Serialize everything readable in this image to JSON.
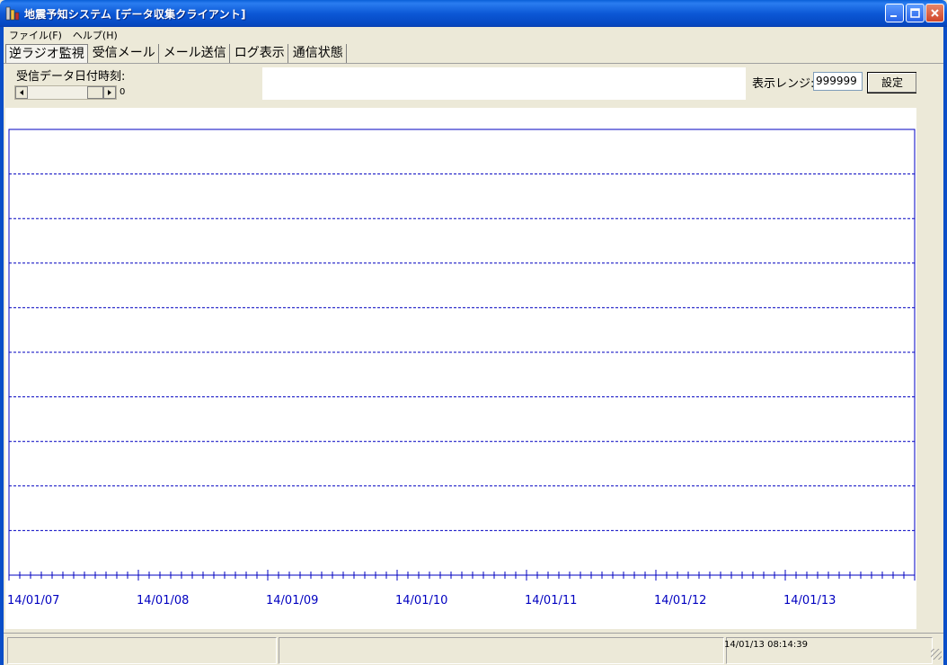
{
  "window": {
    "title": "地震予知システム [データ収集クライアント]",
    "buttons": {
      "minimize": "minimize-icon",
      "maximize": "maximize-icon",
      "close": "close-icon"
    }
  },
  "menu": {
    "items": [
      "ファイル(F)",
      "ヘルプ(H)"
    ]
  },
  "tabs": [
    {
      "label": "逆ラジオ監視",
      "active": true
    },
    {
      "label": "受信メール",
      "active": false
    },
    {
      "label": "メール送信",
      "active": false
    },
    {
      "label": "ログ表示",
      "active": false
    },
    {
      "label": "通信状態",
      "active": false
    }
  ],
  "controls": {
    "recv_label": "受信データ日付時刻:",
    "scroll_value": "0",
    "range_label": "表示レンジ:",
    "range_value": "999999",
    "set_button": "設定"
  },
  "chart_data": {
    "type": "line",
    "x_tick_labels": [
      "14/01/07",
      "14/01/08",
      "14/01/09",
      "14/01/10",
      "14/01/11",
      "14/01/12",
      "14/01/13"
    ],
    "series": [],
    "grid": true,
    "colors": {
      "axis": "#0000c0"
    }
  },
  "status": {
    "panels": [
      "",
      "",
      "14/01/13 08:14:39"
    ]
  }
}
